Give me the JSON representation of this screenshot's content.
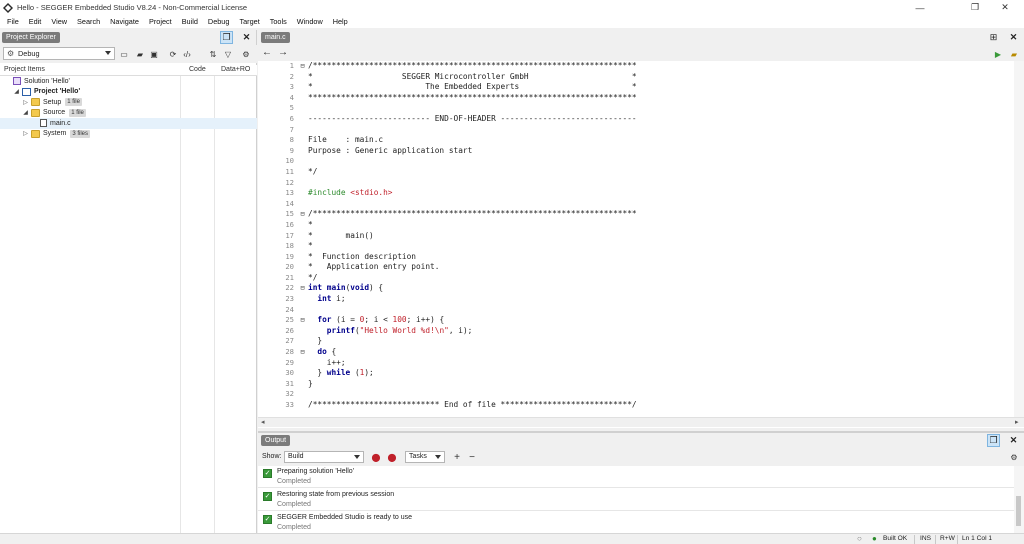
{
  "window": {
    "title": "Hello - SEGGER Embedded Studio V8.24 - Non-Commercial License",
    "minimize_glyph": "—",
    "maximize_glyph": "❐",
    "close_glyph": "✕"
  },
  "menu": [
    "File",
    "Edit",
    "View",
    "Search",
    "Navigate",
    "Project",
    "Build",
    "Debug",
    "Target",
    "Tools",
    "Window",
    "Help"
  ],
  "project_explorer": {
    "tab_label": "Project Explorer",
    "configuration": "Debug",
    "columns": {
      "items": "Project Items",
      "code": "Code",
      "data": "Data+RO"
    },
    "tree": [
      {
        "label": "Solution 'Hello'",
        "indent": 0,
        "expander": "",
        "icon": "solution-icon",
        "bold": false,
        "badge": ""
      },
      {
        "label": "Project 'Hello'",
        "indent": 1,
        "expander": "◢",
        "icon": "project-icon",
        "bold": true,
        "badge": ""
      },
      {
        "label": "Setup",
        "indent": 2,
        "expander": "▷",
        "icon": "folder-icon",
        "bold": false,
        "badge": "1 file"
      },
      {
        "label": "Source",
        "indent": 2,
        "expander": "◢",
        "icon": "folder-icon",
        "bold": false,
        "badge": "1 file"
      },
      {
        "label": "main.c",
        "indent": 3,
        "expander": "",
        "icon": "c-file-icon",
        "bold": false,
        "badge": "",
        "selected": true
      },
      {
        "label": "System",
        "indent": 2,
        "expander": "▷",
        "icon": "folder-icon",
        "bold": false,
        "badge": "3 files"
      }
    ]
  },
  "editor": {
    "tab_label": "main.c",
    "back_glyph": "←",
    "forward_glyph": "→",
    "lines": [
      {
        "n": "1",
        "fold": "⊟",
        "text": "/*********************************************************************",
        "cls": "c-com"
      },
      {
        "n": "2",
        "fold": "",
        "text": "*                   SEGGER Microcontroller GmbH                      *",
        "cls": "c-com"
      },
      {
        "n": "3",
        "fold": "",
        "text": "*                        The Embedded Experts                        *",
        "cls": "c-com"
      },
      {
        "n": "4",
        "fold": "",
        "text": "**********************************************************************",
        "cls": "c-com"
      },
      {
        "n": "5",
        "fold": "",
        "text": "",
        "cls": ""
      },
      {
        "n": "6",
        "fold": "",
        "text": "-------------------------- END-OF-HEADER -----------------------------",
        "cls": "c-com"
      },
      {
        "n": "7",
        "fold": "",
        "text": "",
        "cls": ""
      },
      {
        "n": "8",
        "fold": "",
        "text": "File    : main.c",
        "cls": "c-com"
      },
      {
        "n": "9",
        "fold": "",
        "text": "Purpose : Generic application start",
        "cls": "c-com"
      },
      {
        "n": "10",
        "fold": "",
        "text": "",
        "cls": ""
      },
      {
        "n": "11",
        "fold": "",
        "text": "*/",
        "cls": "c-com"
      },
      {
        "n": "12",
        "fold": "",
        "text": "",
        "cls": ""
      },
      {
        "n": "13",
        "fold": "",
        "html": "<span class=\"c-pp\">#include </span><span class=\"c-inc\">&lt;stdio.h&gt;</span>"
      },
      {
        "n": "14",
        "fold": "",
        "text": "",
        "cls": ""
      },
      {
        "n": "15",
        "fold": "⊟",
        "text": "/*********************************************************************",
        "cls": "c-com"
      },
      {
        "n": "16",
        "fold": "",
        "text": "*",
        "cls": "c-com"
      },
      {
        "n": "17",
        "fold": "",
        "text": "*       main()",
        "cls": "c-com"
      },
      {
        "n": "18",
        "fold": "",
        "text": "*",
        "cls": "c-com"
      },
      {
        "n": "19",
        "fold": "",
        "text": "*  Function description",
        "cls": "c-com"
      },
      {
        "n": "20",
        "fold": "",
        "text": "*   Application entry point.",
        "cls": "c-com"
      },
      {
        "n": "21",
        "fold": "",
        "text": "*/",
        "cls": "c-com"
      },
      {
        "n": "22",
        "fold": "⊟",
        "html": "<span class=\"c-kw\">int main</span>(<span class=\"c-kw\">void</span>) {"
      },
      {
        "n": "23",
        "fold": "",
        "html": "  <span class=\"c-kw\">int</span> i;"
      },
      {
        "n": "24",
        "fold": "",
        "text": "",
        "cls": ""
      },
      {
        "n": "25",
        "fold": "⊟",
        "html": "  <span class=\"c-kw\">for</span> (i = <span class=\"c-num\">0</span>; i &lt; <span class=\"c-num\">100</span>; i++) {"
      },
      {
        "n": "26",
        "fold": "",
        "html": "    <span class=\"c-kw\">printf</span>(<span class=\"c-str\">\"Hello World %d!\\n\"</span>, i);"
      },
      {
        "n": "27",
        "fold": "",
        "text": "  }",
        "cls": ""
      },
      {
        "n": "28",
        "fold": "⊟",
        "html": "  <span class=\"c-kw\">do</span> {"
      },
      {
        "n": "29",
        "fold": "",
        "text": "    i++;",
        "cls": ""
      },
      {
        "n": "30",
        "fold": "",
        "html": "  } <span class=\"c-kw\">while</span> (<span class=\"c-num\">1</span>);"
      },
      {
        "n": "31",
        "fold": "",
        "text": "}",
        "cls": ""
      },
      {
        "n": "32",
        "fold": "",
        "text": "",
        "cls": ""
      },
      {
        "n": "33",
        "fold": "",
        "text": "/*************************** End of file ****************************/",
        "cls": "c-com"
      }
    ]
  },
  "output": {
    "tab_label": "Output",
    "show_label": "Show:",
    "show_value": "Build",
    "tasks_value": "Tasks",
    "add_glyph": "+",
    "remove_glyph": "−",
    "messages": [
      {
        "title": "Preparing solution 'Hello'",
        "status": "Completed"
      },
      {
        "title": "Restoring state from previous session",
        "status": "Completed"
      },
      {
        "title": "SEGGER Embedded Studio is ready to use",
        "status": "Completed"
      }
    ]
  },
  "status": {
    "build": "Built OK",
    "mode": "INS",
    "access": "R+W",
    "position": "Ln 1 Col 1"
  },
  "colors": {
    "tab_bg": "#7b7b7b",
    "comment": "#2e8b2e",
    "keyword": "#00008b",
    "string": "#c0202a"
  }
}
